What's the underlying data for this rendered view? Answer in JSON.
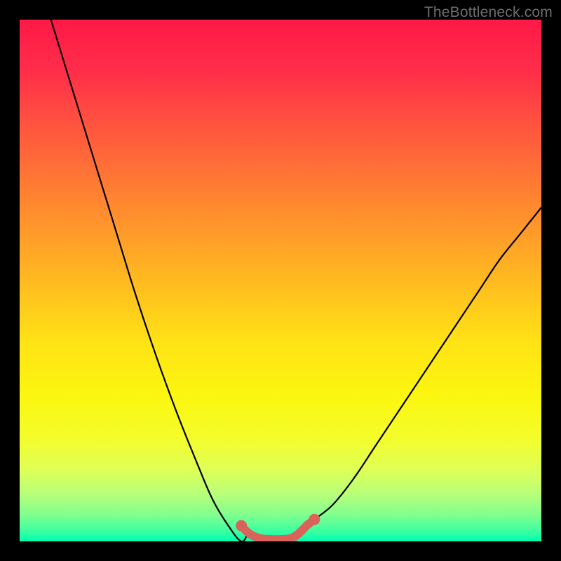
{
  "watermark": {
    "text": "TheBottleneck.com"
  },
  "colors": {
    "curve_stroke": "#000000",
    "valley_stroke": "#d9635a",
    "gradient_top": "#ff1947",
    "gradient_bottom": "#00ffb0",
    "frame": "#000000"
  },
  "chart_data": {
    "type": "line",
    "title": "",
    "xlabel": "",
    "ylabel": "",
    "xlim": [
      0,
      100
    ],
    "ylim": [
      0,
      100
    ],
    "grid": false,
    "legend": false,
    "series": [
      {
        "name": "left-curve",
        "x": [
          6,
          10,
          14,
          18,
          22,
          26,
          30,
          34,
          37,
          40,
          42.5
        ],
        "y": [
          100,
          87,
          74,
          61,
          48,
          36,
          25,
          15,
          8,
          3,
          0
        ]
      },
      {
        "name": "valley",
        "x": [
          42.5,
          44,
          46,
          48,
          50,
          52,
          53.5,
          55,
          56.5
        ],
        "y": [
          3.0,
          1.5,
          0.6,
          0.4,
          0.4,
          0.6,
          1.5,
          3.0,
          4.2
        ]
      },
      {
        "name": "right-curve",
        "x": [
          56.5,
          60,
          64,
          68,
          72,
          76,
          80,
          84,
          88,
          92,
          96,
          100
        ],
        "y": [
          4.2,
          7,
          12,
          18,
          24,
          30,
          36,
          42,
          48,
          54,
          59,
          64
        ]
      }
    ],
    "annotations": [
      {
        "text": "TheBottleneck.com",
        "position": "top-right"
      }
    ]
  }
}
